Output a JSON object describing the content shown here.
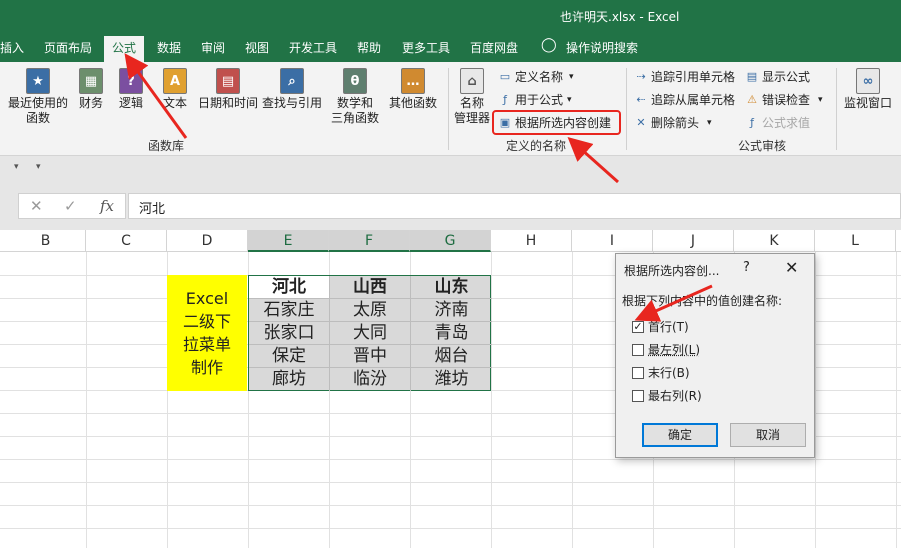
{
  "window": {
    "title": "也许明天.xlsx  -  Excel"
  },
  "tabs": [
    "插入",
    "页面布局",
    "公式",
    "数据",
    "审阅",
    "视图",
    "开发工具",
    "帮助",
    "更多工具",
    "百度网盘",
    "操作说明搜索"
  ],
  "ribbon": {
    "library": {
      "recent": "最近使用的\n函数",
      "finance": "财务",
      "logic": "逻辑",
      "text": "文本",
      "datetime": "日期和时间",
      "lookup": "查找与引用",
      "math": "数学和\n三角函数",
      "other": "其他函数",
      "label": "函数库"
    },
    "names": {
      "manager": "名称\n管理器",
      "define": "定义名称",
      "use": "用于公式",
      "create": "根据所选内容创建",
      "label": "定义的名称"
    },
    "audit": {
      "trace_pre": "追踪引用单元格",
      "trace_dep": "追踪从属单元格",
      "remove": "删除箭头",
      "show": "显示公式",
      "error": "错误检查",
      "eval": "公式求值",
      "label": "公式审核"
    },
    "watch": "监视窗口"
  },
  "formula_bar": {
    "content": "河北",
    "fx": "fx"
  },
  "columns": [
    "B",
    "C",
    "D",
    "E",
    "F",
    "G",
    "H",
    "I",
    "J",
    "K",
    "L"
  ],
  "sheet": {
    "note": "Excel\n二级下\n拉菜单\n制作",
    "table": [
      [
        "河北",
        "山西",
        "山东"
      ],
      [
        "石家庄",
        "太原",
        "济南"
      ],
      [
        "张家口",
        "大同",
        "青岛"
      ],
      [
        "保定",
        "晋中",
        "烟台"
      ],
      [
        "廊坊",
        "临汾",
        "潍坊"
      ]
    ]
  },
  "dialog": {
    "title": "根据所选内容创...",
    "help": "?",
    "close": "✕",
    "prompt": "根据下列内容中的值创建名称:",
    "options": [
      {
        "label": "首行(T)",
        "checked": true
      },
      {
        "label": "最左列(L)",
        "checked": false
      },
      {
        "label": "末行(B)",
        "checked": false
      },
      {
        "label": "最右列(R)",
        "checked": false
      }
    ],
    "ok": "确定",
    "cancel": "取消"
  },
  "colors": {
    "excel_green": "#217346",
    "note_bg": "#ffff00",
    "annotation_red": "#e8261f"
  }
}
